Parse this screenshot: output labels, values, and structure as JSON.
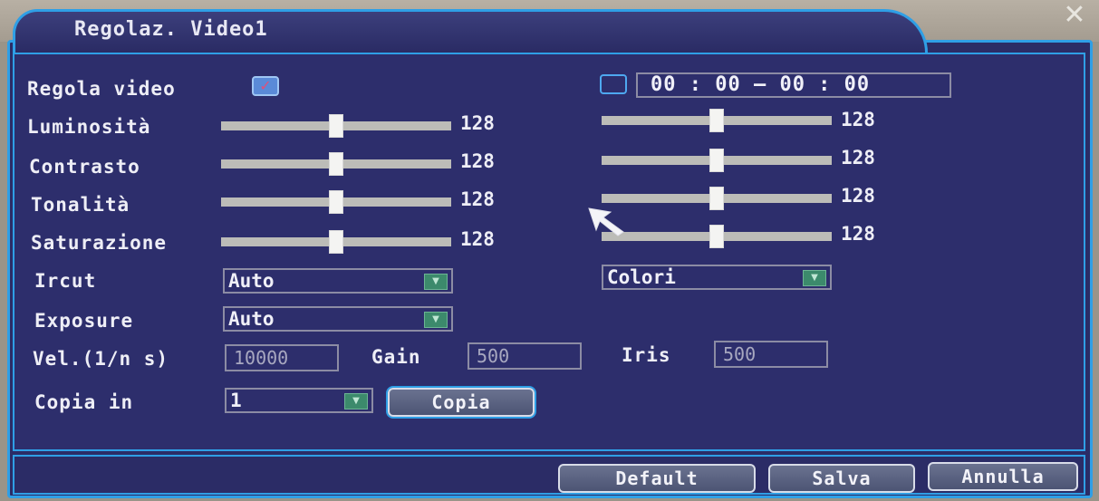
{
  "window": {
    "title": "Regolaz. Video1",
    "close_glyph": "✕"
  },
  "regola_video": {
    "label": "Regola video",
    "checked": true,
    "check_glyph": "✓"
  },
  "schedule": {
    "checked": false,
    "time_range": "00 : 00 — 00 : 00"
  },
  "sliders": [
    {
      "label": "Luminosità",
      "value": "128",
      "level": 0.5,
      "schedule_value": "128",
      "schedule_level": 0.5
    },
    {
      "label": "Contrasto",
      "value": "128",
      "level": 0.5,
      "schedule_value": "128",
      "schedule_level": 0.5
    },
    {
      "label": "Tonalità",
      "value": "128",
      "level": 0.5,
      "schedule_value": "128",
      "schedule_level": 0.5
    },
    {
      "label": "Saturazione",
      "value": "128",
      "level": 0.5,
      "schedule_value": "128",
      "schedule_level": 0.5
    }
  ],
  "ircut": {
    "label": "Ircut",
    "value": "Auto",
    "color_mode": "Colori"
  },
  "exposure": {
    "label": "Exposure",
    "value": "Auto"
  },
  "shutter": {
    "label": "Vel.(1/n s)",
    "value": "10000"
  },
  "gain": {
    "label": "Gain",
    "value": "500"
  },
  "iris": {
    "label": "Iris",
    "value": "500"
  },
  "copy": {
    "label": "Copia in",
    "value": "1",
    "button": "Copia"
  },
  "footer": {
    "default": "Default",
    "save": "Salva",
    "cancel": "Annulla"
  },
  "colors": {
    "panel": "#2d2e6c",
    "border_accent": "#2f9fe6",
    "dropdown_arrow": "#3c8a6c",
    "checkbox": "#5a8ad8"
  },
  "icons": {
    "dropdown": "chevron-down-icon",
    "cursor": "mouse-pointer-icon",
    "close": "close-icon"
  }
}
